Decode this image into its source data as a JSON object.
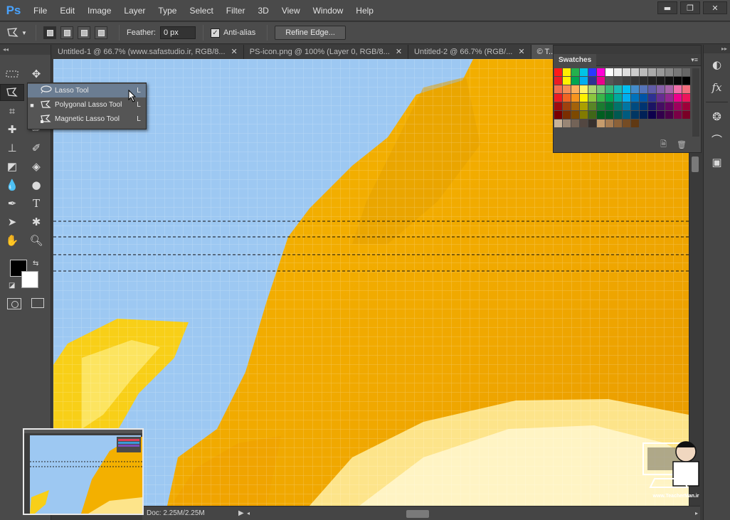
{
  "app": {
    "logo": "Ps"
  },
  "menu": [
    "File",
    "Edit",
    "Image",
    "Layer",
    "Type",
    "Select",
    "Filter",
    "3D",
    "View",
    "Window",
    "Help"
  ],
  "window_controls": {
    "minimize": "▬",
    "restore": "❐",
    "close": "✕"
  },
  "options": {
    "feather_label": "Feather:",
    "feather_value": "0 px",
    "antialias_label": "Anti-alias",
    "antialias_checked": true,
    "refine_edge_label": "Refine Edge..."
  },
  "tabs": [
    {
      "label": "Untitled-1 @ 66.7% (www.safastudio.ir, RGB/8...",
      "close": "✕",
      "active": false
    },
    {
      "label": "PS-icon.png @ 100% (Layer 0, RGB/8...",
      "close": "✕",
      "active": false
    },
    {
      "label": "Untitled-2 @ 66.7% (RGB/...",
      "close": "✕",
      "active": false
    },
    {
      "label": "© T...",
      "close": "",
      "active": true
    }
  ],
  "flyout": {
    "items": [
      {
        "label": "Lasso Tool",
        "shortcut": "L",
        "icon": "lasso-icon",
        "current": false,
        "highlighted": true
      },
      {
        "label": "Polygonal Lasso Tool",
        "shortcut": "L",
        "icon": "polygonal-lasso-icon",
        "current": true,
        "highlighted": false
      },
      {
        "label": "Magnetic Lasso Tool",
        "shortcut": "L",
        "icon": "magnetic-lasso-icon",
        "current": false,
        "highlighted": false
      }
    ]
  },
  "swatches": {
    "title": "Swatches",
    "menu_icon": "▾≡",
    "colors": [
      "#ff1a1a",
      "#ffee00",
      "#23b14d",
      "#00c4e6",
      "#2a38ff",
      "#ff00d4",
      "#ffffff",
      "#eeeeee",
      "#dddddd",
      "#cccccc",
      "#bbbbbb",
      "#aaaaaa",
      "#999999",
      "#888888",
      "#777777",
      "#666666",
      "#ed1c24",
      "#fff200",
      "#00a651",
      "#00aeef",
      "#2e3192",
      "#ec008c",
      "#555555",
      "#4a4a4a",
      "#404040",
      "#363636",
      "#2c2c2c",
      "#222222",
      "#1a1a1a",
      "#111111",
      "#080808",
      "#000000",
      "#f26c4f",
      "#f68e55",
      "#fbaf5c",
      "#fff467",
      "#acd372",
      "#7cc576",
      "#3bb878",
      "#1abbb4",
      "#00bff3",
      "#438ccb",
      "#5574b9",
      "#605ca8",
      "#855fa8",
      "#a763a8",
      "#f06ea9",
      "#f26d7d",
      "#ed1c24",
      "#f26522",
      "#f7941d",
      "#fff200",
      "#8dc63f",
      "#39b54a",
      "#00a651",
      "#00a99d",
      "#00aeef",
      "#0072bc",
      "#0054a6",
      "#2e3192",
      "#662d91",
      "#92278f",
      "#ec008c",
      "#ed145b",
      "#9e0b0f",
      "#a0410d",
      "#a3620a",
      "#aba000",
      "#598527",
      "#1a7b30",
      "#007236",
      "#00746b",
      "#0076a3",
      "#004b80",
      "#003471",
      "#1b1464",
      "#440e62",
      "#630460",
      "#9e005d",
      "#9e0039",
      "#790000",
      "#7b2e00",
      "#7d4900",
      "#827b00",
      "#406618",
      "#005e20",
      "#005826",
      "#005952",
      "#005b7f",
      "#003663",
      "#002157",
      "#0d004c",
      "#32004b",
      "#4b0049",
      "#7b0046",
      "#7a0026",
      "#c7b299",
      "#998675",
      "#736357",
      "#534741",
      "#37302d",
      "#c69c6d",
      "#a67c52",
      "#8c6239",
      "#754c24",
      "#603913"
    ],
    "footer": {
      "new": "🗎",
      "delete": "🗑"
    }
  },
  "status": {
    "doc_info": "Doc: 2.25M/2.25M",
    "arrow": "▶"
  },
  "watermark": {
    "text": "www.TeacherMan.ir"
  }
}
